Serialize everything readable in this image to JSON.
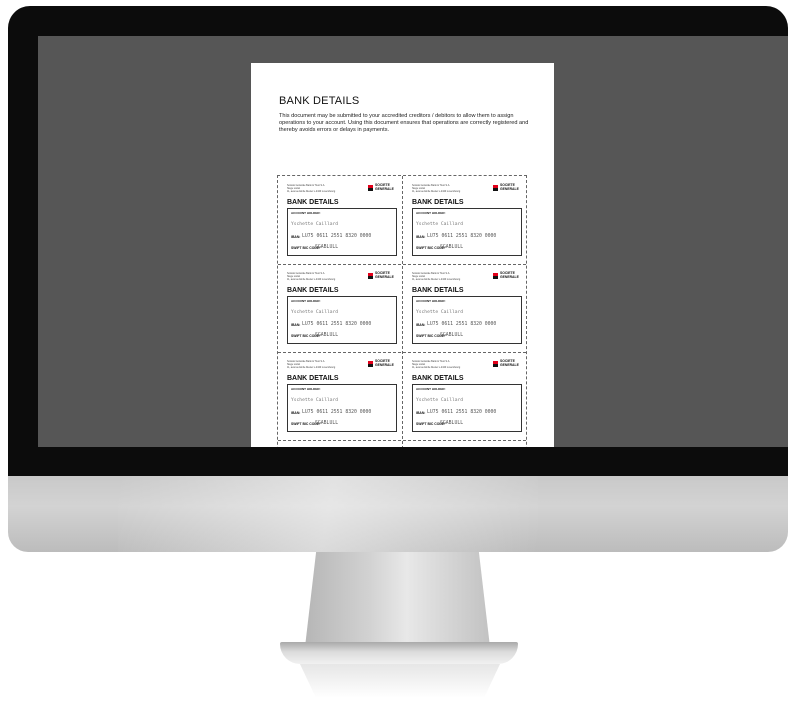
{
  "document": {
    "title": "BANK DETAILS",
    "intro": "This document may be submitted to your accredited creditors / debitors to allow them to assign operations to your account. Using this document ensures that operations are correctly registered and thereby avoids errors or delays in payments."
  },
  "card": {
    "address_line1": "Société Générale Bank & Trust S.A.",
    "address_line2": "Siège social",
    "address_line3": "11, avenue Emile Reuter L-2420 Luxembourg",
    "logo_line1": "SOCIETE",
    "logo_line2": "GENERALE",
    "title": "BANK DETAILS",
    "holder_label": "ACCOUNT HOLDER:",
    "holder_name": "Yschette Caillard",
    "iban_label": "IBAN:",
    "iban": "LU75 0611 2551 8320 0000",
    "swift_label": "SWIFT BIC CODE:",
    "swift": "SGABLULL"
  },
  "colors": {
    "brand_red": "#e2001a",
    "screen_bg": "#565656",
    "bezel": "#0c0c0c"
  }
}
